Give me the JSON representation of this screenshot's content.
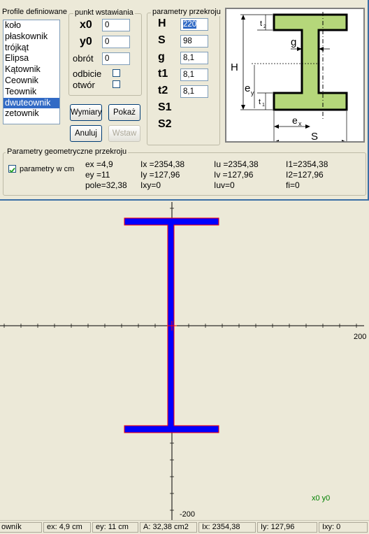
{
  "profiles": {
    "title": "Profile definiowane",
    "items": [
      "koło",
      "płaskownik",
      "trójkąt",
      "Elipsa",
      "Kątownik",
      "Ceownik",
      "Teownik",
      "dwuteownik",
      "zetownik"
    ],
    "selected_index": 7
  },
  "insert_point": {
    "title": "punkt wstawiania",
    "x0_label": "x0",
    "x0_value": "0",
    "y0_label": "y0",
    "y0_value": "0",
    "rotation_label": "obrót",
    "rotation_value": "0",
    "mirror_label": "odbicie",
    "hole_label": "otwór"
  },
  "buttons": {
    "dimensions": "Wymiary",
    "show": "Pokaż",
    "cancel": "Anuluj",
    "insert": "Wstaw"
  },
  "section_params": {
    "title": "parametry przekroju",
    "rows": [
      {
        "label": "H",
        "value": "220"
      },
      {
        "label": "S",
        "value": "98"
      },
      {
        "label": "g",
        "value": "8,1"
      },
      {
        "label": "t1",
        "value": "8,1"
      },
      {
        "label": "t2",
        "value": "8,1"
      },
      {
        "label": "S1",
        "value": ""
      },
      {
        "label": "S2",
        "value": ""
      }
    ]
  },
  "sketch": {
    "labels": {
      "H": "H",
      "t2": "t",
      "t2_sub": "2",
      "g": "g",
      "ey": "e",
      "ey_sub": "y",
      "t1": "t",
      "t1_sub": "1",
      "ex": "e",
      "ex_sub": "x",
      "S": "S"
    },
    "fill_color": "#b5d77a"
  },
  "geometry": {
    "title": "Parametry geometryczne przekroju",
    "units_checkbox_label": "parametry w cm",
    "cells": [
      [
        "ex =4,9",
        "Ix =2354,38",
        "Iu =2354,38",
        "I1=2354,38"
      ],
      [
        "ey =11",
        "Iy =127,96",
        "Iv =127,96",
        "I2=127,96"
      ],
      [
        "pole=32,38",
        "Ixy=0",
        "Iuv=0",
        "fi=0"
      ]
    ]
  },
  "canvas": {
    "x_tick_label": "200",
    "y_tick_label": "-200",
    "origin_label": "x0 y0",
    "section_color": "#0000ff",
    "outline_color": "#ff0000",
    "origin_label_color": "#008000"
  },
  "status": [
    "owník",
    "ex:  4,9 cm",
    "ey:  11 cm",
    "A:   32,38 cm2",
    "Ix:  2354,38",
    "Iy:   127,96",
    "Ixy: 0"
  ]
}
